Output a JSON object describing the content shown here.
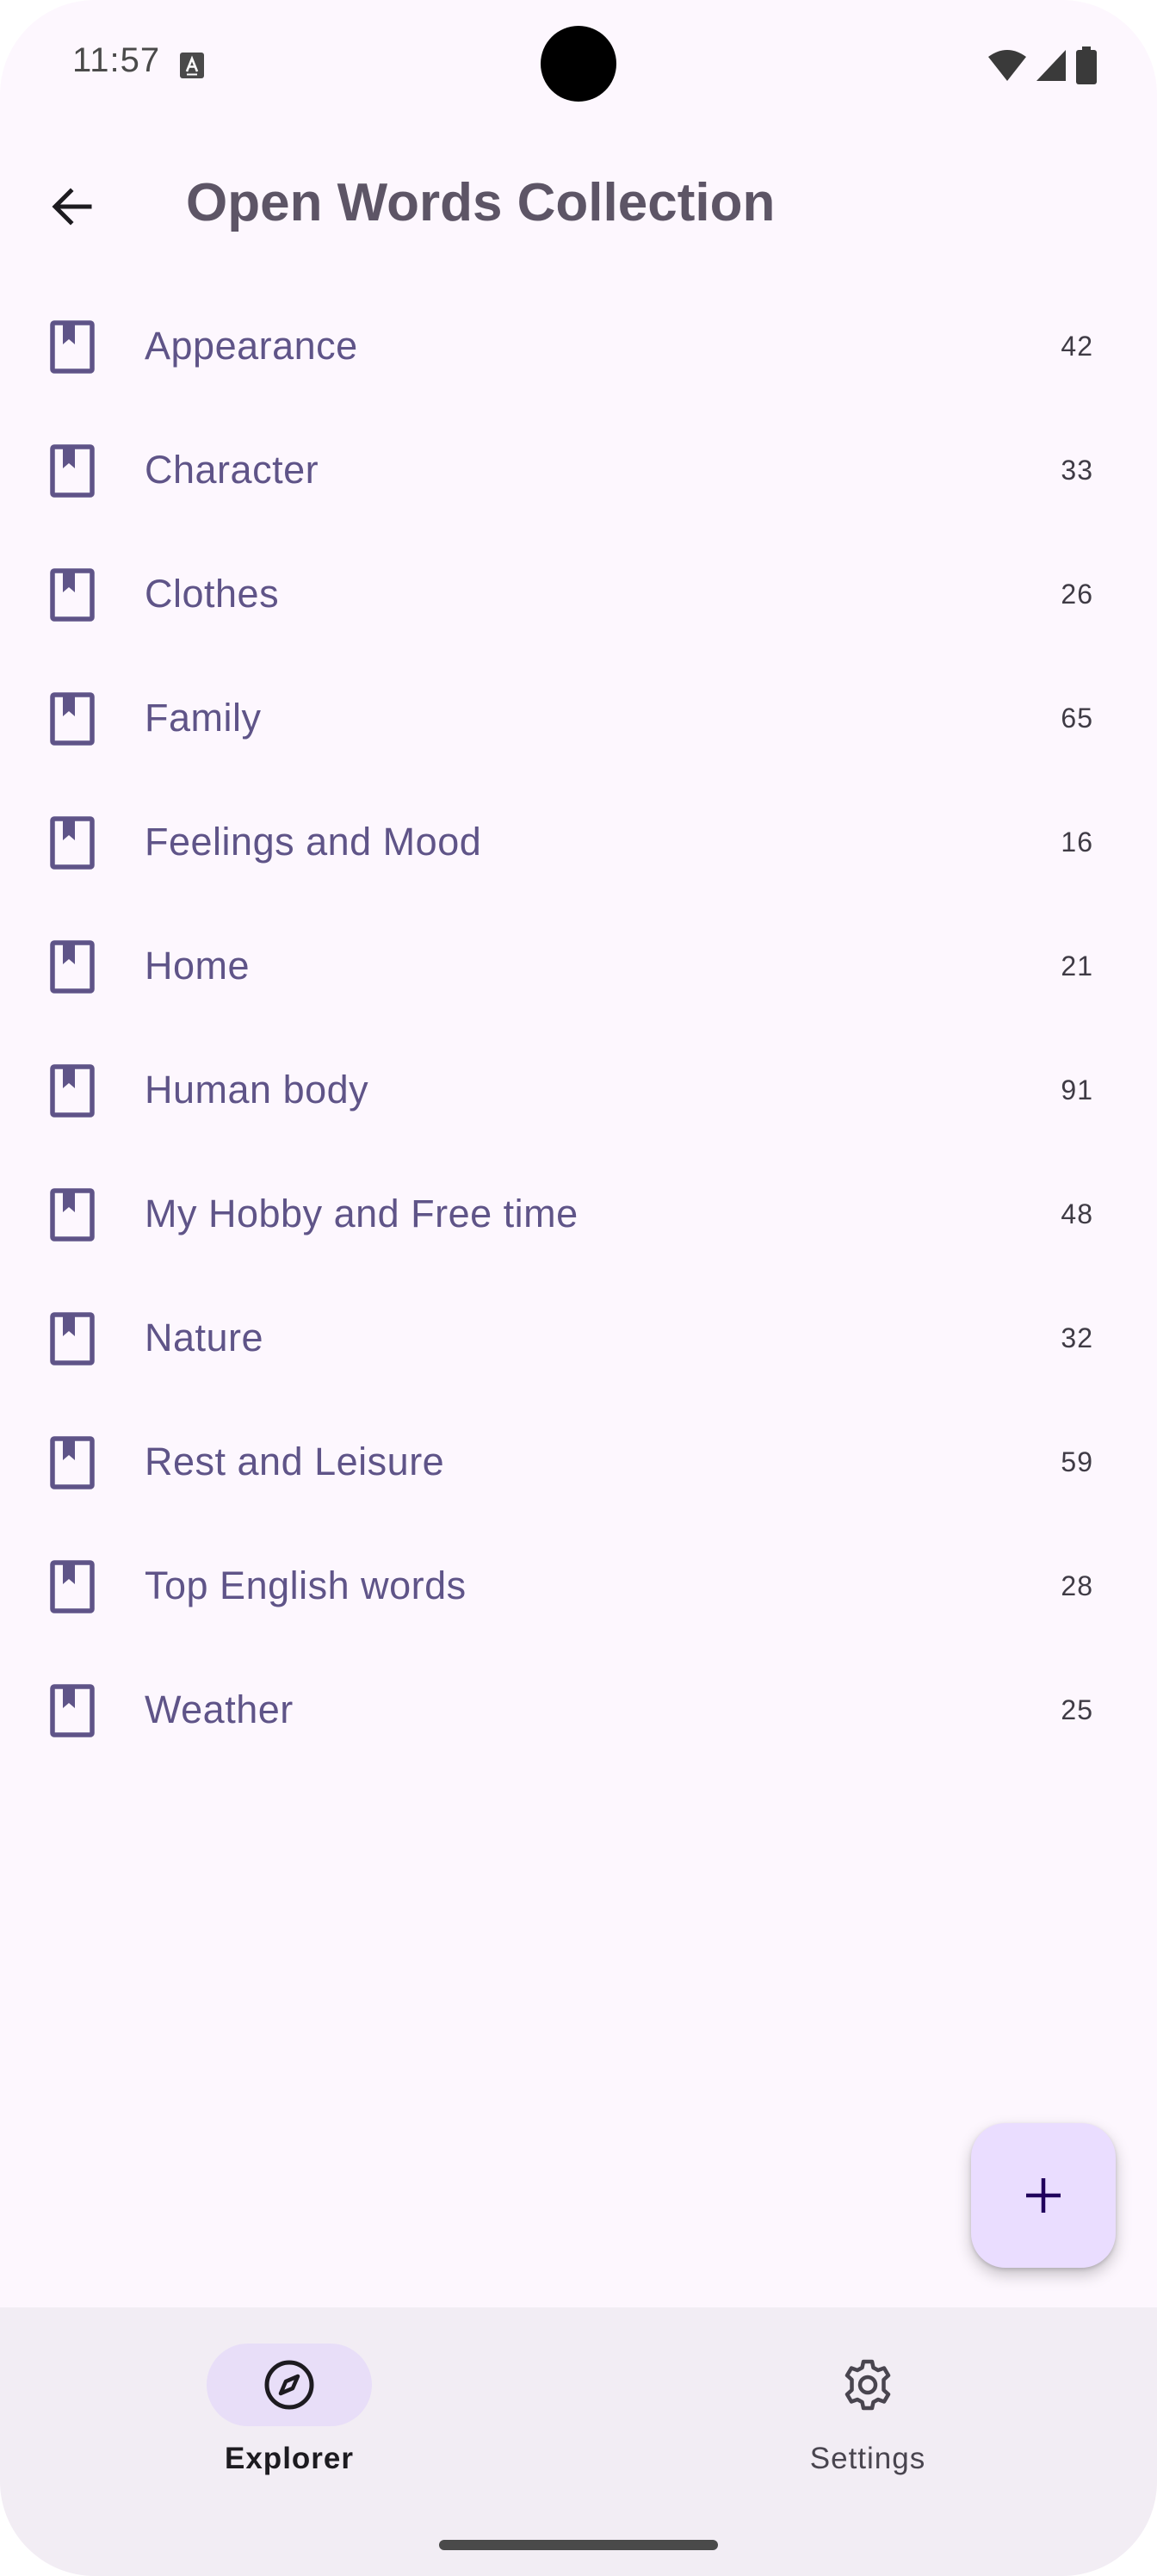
{
  "status_bar": {
    "time": "11:57",
    "notification_icon": "a-badge-icon",
    "icons": [
      "wifi-icon",
      "signal-icon",
      "battery-icon"
    ]
  },
  "app_bar": {
    "back_icon": "arrow-left-icon",
    "title": "Open Words Collection"
  },
  "collections": [
    {
      "label": "Appearance",
      "count": "42",
      "icon": "bookmark-book-icon"
    },
    {
      "label": "Character",
      "count": "33",
      "icon": "bookmark-book-icon"
    },
    {
      "label": "Clothes",
      "count": "26",
      "icon": "bookmark-book-icon"
    },
    {
      "label": "Family",
      "count": "65",
      "icon": "bookmark-book-icon"
    },
    {
      "label": "Feelings and Mood",
      "count": "16",
      "icon": "bookmark-book-icon"
    },
    {
      "label": "Home",
      "count": "21",
      "icon": "bookmark-book-icon"
    },
    {
      "label": "Human body",
      "count": "91",
      "icon": "bookmark-book-icon"
    },
    {
      "label": "My Hobby and Free time",
      "count": "48",
      "icon": "bookmark-book-icon"
    },
    {
      "label": "Nature",
      "count": "32",
      "icon": "bookmark-book-icon"
    },
    {
      "label": "Rest and Leisure",
      "count": "59",
      "icon": "bookmark-book-icon"
    },
    {
      "label": "Top English words",
      "count": "28",
      "icon": "bookmark-book-icon"
    },
    {
      "label": "Weather",
      "count": "25",
      "icon": "bookmark-book-icon"
    }
  ],
  "fab": {
    "icon": "plus-icon"
  },
  "bottom_nav": {
    "items": [
      {
        "label": "Explorer",
        "icon": "compass-icon",
        "selected": true
      },
      {
        "label": "Settings",
        "icon": "gear-icon",
        "selected": false
      }
    ]
  },
  "colors": {
    "background": "#FDF7FE",
    "accent": "#5F5488",
    "fab": "#EADDFF",
    "nav_background": "#F2EDF4",
    "nav_indicator": "#E8DEF8"
  }
}
